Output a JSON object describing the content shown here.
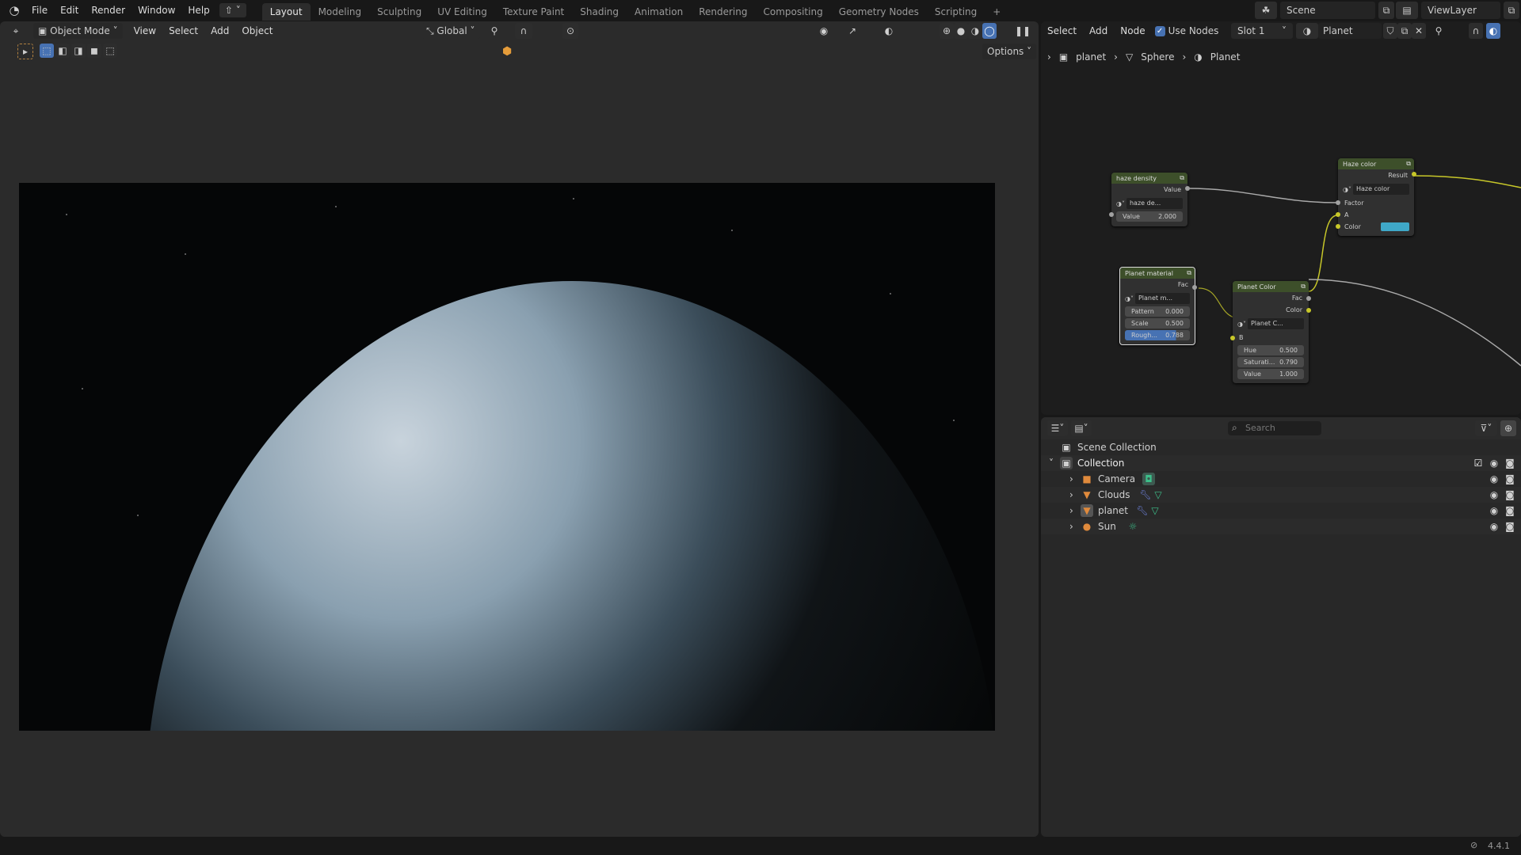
{
  "topbar": {
    "menus": [
      "File",
      "Edit",
      "Render",
      "Window",
      "Help"
    ],
    "workspaces": [
      "Layout",
      "Modeling",
      "Sculpting",
      "UV Editing",
      "Texture Paint",
      "Shading",
      "Animation",
      "Rendering",
      "Compositing",
      "Geometry Nodes",
      "Scripting"
    ],
    "active_workspace": "Layout",
    "add_tab": "+",
    "scene": "Scene",
    "view_layer": "ViewLayer"
  },
  "viewport": {
    "mode": "Object Mode",
    "menus": [
      "View",
      "Select",
      "Add",
      "Object"
    ],
    "orientation": "Global",
    "options": "Options"
  },
  "node_editor": {
    "menus": [
      "Select",
      "Add",
      "Node"
    ],
    "use_nodes_label": "Use Nodes",
    "use_nodes": true,
    "slot": "Slot 1",
    "material": "Planet",
    "breadcrumb": [
      "planet",
      "Sphere",
      "Planet"
    ],
    "nodes": {
      "haze_density": {
        "title": "haze density",
        "output": "Value",
        "group": "haze de...",
        "field_label": "Value",
        "field_value": "2.000"
      },
      "haze_color": {
        "title": "Haze color",
        "output": "Result",
        "group": "Haze color",
        "inputs": [
          "Factor",
          "A",
          "Color"
        ],
        "color": "#3fa8c8"
      },
      "planet_material": {
        "title": "Planet material",
        "output": "Fac",
        "group": "Planet m...",
        "fields": [
          {
            "label": "Pattern",
            "value": "0.000"
          },
          {
            "label": "Scale",
            "value": "0.500"
          },
          {
            "label": "Rough...",
            "value": "0.788"
          }
        ],
        "roughness_fraction": 0.788
      },
      "planet_color": {
        "title": "Planet Color",
        "outputs": [
          "Fac",
          "Color"
        ],
        "group": "Planet C...",
        "input": "B",
        "fields": [
          {
            "label": "Hue",
            "value": "0.500"
          },
          {
            "label": "Saturati...",
            "value": "0.790"
          },
          {
            "label": "Value",
            "value": "1.000"
          }
        ]
      }
    }
  },
  "outliner": {
    "search_placeholder": "Search",
    "scene_collection": "Scene Collection",
    "collection": "Collection",
    "items": [
      {
        "name": "Camera",
        "icon": "camera-icon"
      },
      {
        "name": "Clouds",
        "icon": "mesh-icon"
      },
      {
        "name": "planet",
        "icon": "mesh-icon"
      },
      {
        "name": "Sun",
        "icon": "light-icon"
      }
    ]
  },
  "status": {
    "version": "4.4.1"
  }
}
